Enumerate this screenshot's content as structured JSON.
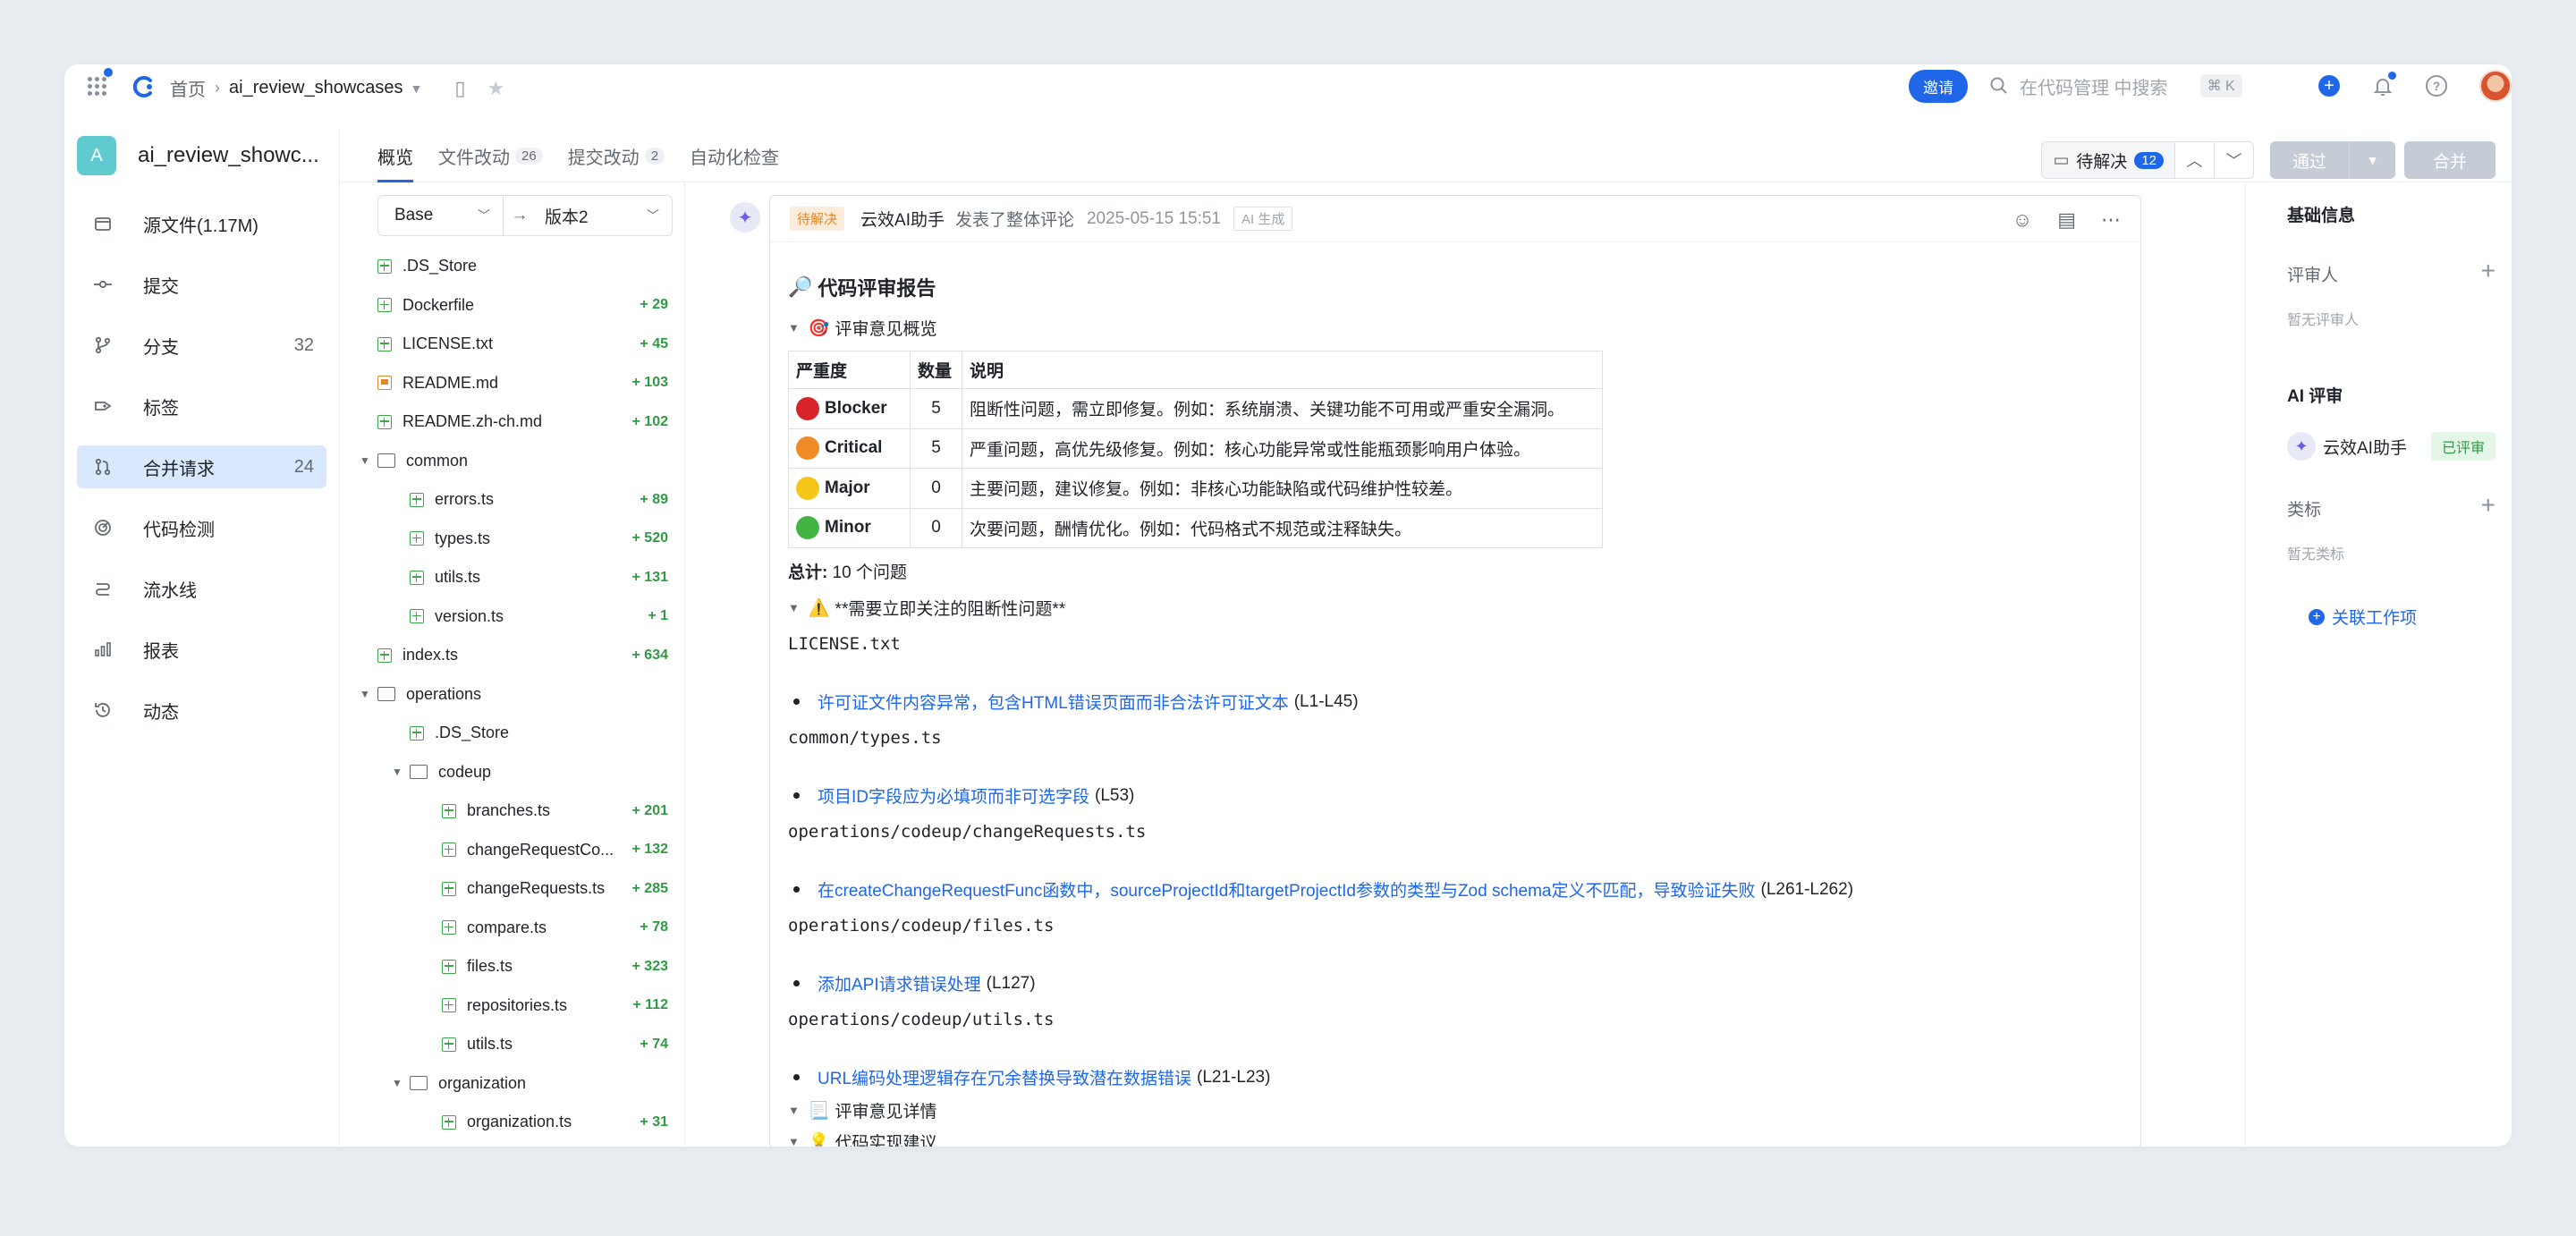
{
  "topbar": {
    "breadcrumb_home": "首页",
    "breadcrumb_repo": "ai_review_showcases",
    "invite_label": "邀请",
    "search_placeholder": "在代码管理 中搜索",
    "search_shortcut": "⌘ K"
  },
  "leftnav": {
    "repo_badge": "A",
    "repo_name": "ai_review_showc...",
    "items": [
      {
        "label": "源文件(1.17M)",
        "icon": "code-file-icon",
        "count": ""
      },
      {
        "label": "提交",
        "icon": "commit-icon",
        "count": ""
      },
      {
        "label": "分支",
        "icon": "branch-icon",
        "count": "32"
      },
      {
        "label": "标签",
        "icon": "tag-icon",
        "count": ""
      },
      {
        "label": "合并请求",
        "icon": "merge-request-icon",
        "count": "24"
      },
      {
        "label": "代码检测",
        "icon": "scan-icon",
        "count": ""
      },
      {
        "label": "流水线",
        "icon": "pipeline-icon",
        "count": ""
      },
      {
        "label": "报表",
        "icon": "chart-icon",
        "count": ""
      },
      {
        "label": "动态",
        "icon": "history-icon",
        "count": ""
      }
    ]
  },
  "tabs": {
    "overview": "概览",
    "file_changes": "文件改动",
    "file_changes_count": "26",
    "commit_changes": "提交改动",
    "commit_changes_count": "2",
    "auto_check": "自动化检查",
    "pending_label": "待解决",
    "pending_count": "12",
    "approve_label": "通过",
    "merge_label": "合并"
  },
  "filetree": {
    "base_label": "Base",
    "version_label": "版本2",
    "rows": [
      {
        "name": ".DS_Store",
        "add": "",
        "type": "added"
      },
      {
        "name": "Dockerfile",
        "add": "+ 29",
        "type": "added"
      },
      {
        "name": "LICENSE.txt",
        "add": "+ 45",
        "type": "added"
      },
      {
        "name": "README.md",
        "add": "+ 103",
        "type": "modified"
      },
      {
        "name": "README.zh-ch.md",
        "add": "+ 102",
        "type": "added"
      },
      {
        "name": "common",
        "add": "",
        "type": "folder"
      },
      {
        "name": "errors.ts",
        "add": "+ 89",
        "type": "added"
      },
      {
        "name": "types.ts",
        "add": "+ 520",
        "type": "added"
      },
      {
        "name": "utils.ts",
        "add": "+ 131",
        "type": "added"
      },
      {
        "name": "version.ts",
        "add": "+ 1",
        "type": "added"
      },
      {
        "name": "index.ts",
        "add": "+ 634",
        "type": "added"
      },
      {
        "name": "operations",
        "add": "",
        "type": "folder"
      },
      {
        "name": ".DS_Store",
        "add": "",
        "type": "added"
      },
      {
        "name": "codeup",
        "add": "",
        "type": "folder"
      },
      {
        "name": "branches.ts",
        "add": "+ 201",
        "type": "added"
      },
      {
        "name": "changeRequestCo...",
        "add": "+ 132",
        "type": "added"
      },
      {
        "name": "changeRequests.ts",
        "add": "+ 285",
        "type": "added"
      },
      {
        "name": "compare.ts",
        "add": "+ 78",
        "type": "added"
      },
      {
        "name": "files.ts",
        "add": "+ 323",
        "type": "added"
      },
      {
        "name": "repositories.ts",
        "add": "+ 112",
        "type": "added"
      },
      {
        "name": "utils.ts",
        "add": "+ 74",
        "type": "added"
      },
      {
        "name": "organization",
        "add": "",
        "type": "folder"
      },
      {
        "name": "organization.ts",
        "add": "+ 31",
        "type": "added"
      }
    ]
  },
  "comment": {
    "status_tag": "待解决",
    "author": "云效AI助手",
    "action": "发表了整体评论",
    "time": "2025-05-15 15:51",
    "ai_tag": "AI 生成",
    "report_title": "代码评审报告",
    "summary_label": "评审意见概览",
    "table_headers": [
      "严重度",
      "数量",
      "说明"
    ],
    "severity_rows": [
      {
        "name": "Blocker",
        "count": "5",
        "desc": "阻断性问题，需立即修复。例如：系统崩溃、关键功能不可用或严重安全漏洞。",
        "color": "#d8232a"
      },
      {
        "name": "Critical",
        "count": "5",
        "desc": "严重问题，高优先级修复。例如：核心功能异常或性能瓶颈影响用户体验。",
        "color": "#f08a24"
      },
      {
        "name": "Major",
        "count": "0",
        "desc": "主要问题，建议修复。例如：非核心功能缺陷或代码维护性较差。",
        "color": "#f5c518"
      },
      {
        "name": "Minor",
        "count": "0",
        "desc": "次要问题，酬情优化。例如：代码格式不规范或注释缺失。",
        "color": "#43b443"
      }
    ],
    "total_label": "总计:",
    "total_value": "10 个问题",
    "blocker_heading": "**需要立即关注的阻断性问题**",
    "issues": [
      {
        "file": "LICENSE.txt",
        "text": "许可证文件内容异常，包含HTML错误页面而非合法许可证文本",
        "lines": "(L1-L45)"
      },
      {
        "file": "common/types.ts",
        "text": "项目ID字段应为必填项而非可选字段",
        "lines": "(L53)"
      },
      {
        "file": "operations/codeup/changeRequests.ts",
        "text": "在createChangeRequestFunc函数中，sourceProjectId和targetProjectId参数的类型与Zod schema定义不匹配，导致验证失败",
        "lines": "(L261-L262)"
      },
      {
        "file": "operations/codeup/files.ts",
        "text": "添加API请求错误处理",
        "lines": "(L127)"
      },
      {
        "file": "operations/codeup/utils.ts",
        "text": "URL编码处理逻辑存在冗余替换导致潜在数据错误",
        "lines": "(L21-L23)"
      }
    ],
    "details_label": "评审意见详情",
    "suggestion_label": "代码实现建议"
  },
  "rightpanel": {
    "basic_info": "基础信息",
    "reviewer_label": "评审人",
    "reviewer_empty": "暂无评审人",
    "ai_review_title": "AI 评审",
    "ai_assistant": "云效AI助手",
    "ai_status": "已评审",
    "label_title": "类标",
    "label_empty": "暂无类标",
    "link_work_item": "关联工作项"
  },
  "colors": {
    "accent": "#1f67e8",
    "added": "#2f9a43",
    "pending": "#e0882a"
  }
}
